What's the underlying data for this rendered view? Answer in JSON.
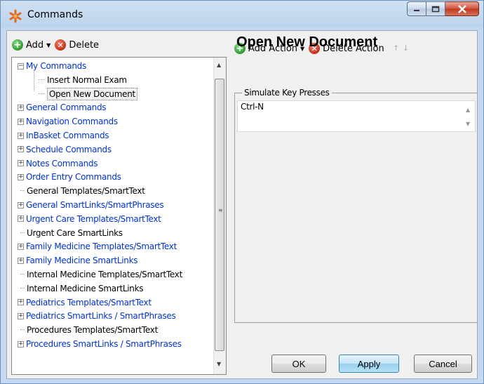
{
  "window": {
    "title": "Commands",
    "app_icon": "asterisk-icon"
  },
  "left_toolbar": {
    "add_label": "Add",
    "delete_label": "Delete"
  },
  "right_toolbar": {
    "add_action_label": "Add Action",
    "delete_action_label": "Delete Action",
    "up_icon": "arrow-up-icon",
    "down_icon": "arrow-down-icon"
  },
  "tree": {
    "items": [
      {
        "label": "My Commands",
        "expander": "−",
        "link": true
      },
      {
        "label": "Insert Normal Exam",
        "expander": "",
        "link": false
      },
      {
        "label": "Open New Document",
        "expander": "",
        "link": false,
        "selected": true
      },
      {
        "label": "General Commands",
        "expander": "+",
        "link": true
      },
      {
        "label": "Navigation Commands",
        "expander": "+",
        "link": true
      },
      {
        "label": "InBasket Commands",
        "expander": "+",
        "link": true
      },
      {
        "label": "Schedule Commands",
        "expander": "+",
        "link": true
      },
      {
        "label": "Notes Commands",
        "expander": "+",
        "link": true
      },
      {
        "label": "Order Entry Commands",
        "expander": "+",
        "link": true
      },
      {
        "label": "General Templates/SmartText",
        "expander": "",
        "link": false
      },
      {
        "label": "General SmartLinks/SmartPhrases",
        "expander": "+",
        "link": true
      },
      {
        "label": "Urgent Care Templates/SmartText",
        "expander": "+",
        "link": true
      },
      {
        "label": "Urgent Care SmartLinks",
        "expander": "",
        "link": false
      },
      {
        "label": "Family Medicine Templates/SmartText",
        "expander": "+",
        "link": true
      },
      {
        "label": "Family Medicine SmartLinks",
        "expander": "+",
        "link": true
      },
      {
        "label": "Internal Medicine Templates/SmartText",
        "expander": "",
        "link": false
      },
      {
        "label": "Internal Medicine SmartLinks",
        "expander": "",
        "link": false
      },
      {
        "label": "Pediatrics Templates/SmartText",
        "expander": "+",
        "link": true
      },
      {
        "label": "Pediatrics SmartLinks / SmartPhrases",
        "expander": "+",
        "link": true
      },
      {
        "label": "Procedures Templates/SmartText",
        "expander": "",
        "link": false
      },
      {
        "label": "Procedures SmartLinks / SmartPhrases",
        "expander": "+",
        "link": true
      }
    ]
  },
  "detail": {
    "title": "Open New Document",
    "group_label": "Simulate Key Presses",
    "keys_value": "Ctrl-N"
  },
  "buttons": {
    "ok": "OK",
    "apply": "Apply",
    "cancel": "Cancel"
  },
  "colors": {
    "link": "#0033cc",
    "add_green": "#2e9a2e",
    "delete_red": "#c22b14",
    "close_red": "#c2361d"
  }
}
